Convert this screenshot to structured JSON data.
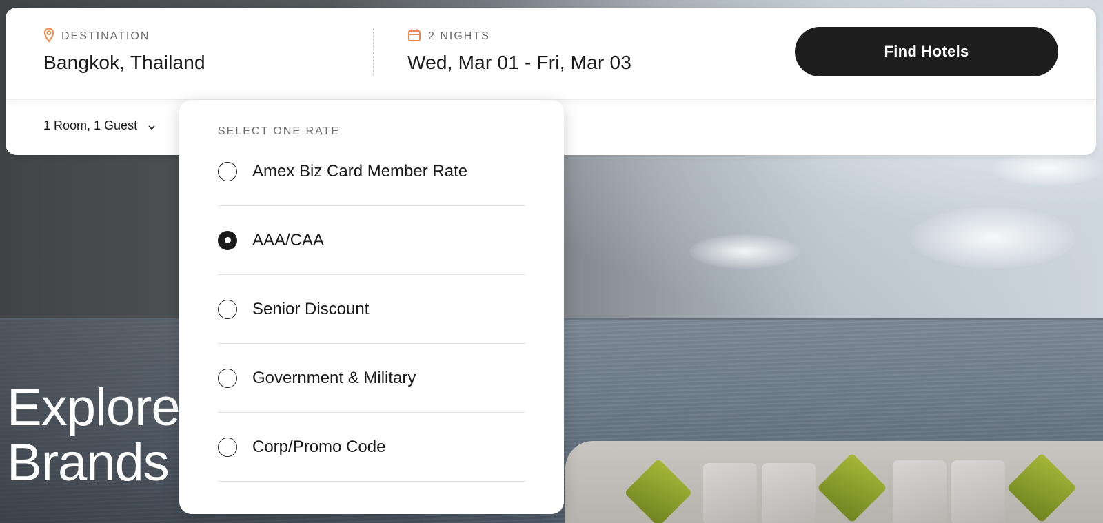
{
  "search": {
    "destination": {
      "label": "DESTINATION",
      "value": "Bangkok, Thailand",
      "icon": "location-pin-icon"
    },
    "dates": {
      "label": "2 NIGHTS",
      "value": "Wed, Mar 01 - Fri, Mar 03",
      "icon": "calendar-icon"
    },
    "find_button_label": "Find Hotels",
    "rooms_guests": "1 Room, 1 Guest"
  },
  "hero": {
    "line1": "Explore",
    "line2": "Brands"
  },
  "rate_dropdown": {
    "heading": "SELECT ONE RATE",
    "options": [
      {
        "label": "Amex Biz Card Member Rate",
        "selected": false
      },
      {
        "label": "AAA/CAA",
        "selected": true
      },
      {
        "label": "Senior Discount",
        "selected": false
      },
      {
        "label": "Government & Military",
        "selected": false
      },
      {
        "label": "Corp/Promo Code",
        "selected": false
      }
    ]
  },
  "colors": {
    "accent_icon": "#f0874a",
    "button_bg": "#1d1d1d",
    "panel_bg": "#ffffff"
  }
}
